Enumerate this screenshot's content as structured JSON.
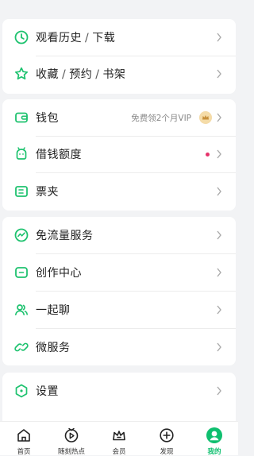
{
  "menu_groups": [
    [
      {
        "parts": [
          "观看历史",
          "下载"
        ]
      },
      {
        "parts": [
          "收藏",
          "预约",
          "书架"
        ]
      }
    ],
    [
      {
        "label": "钱包",
        "note": "免费领2个月VIP"
      },
      {
        "label": "借钱额度"
      },
      {
        "label": "票夹"
      }
    ],
    [
      {
        "label": "免流量服务"
      },
      {
        "label": "创作中心"
      },
      {
        "label": "一起聊"
      },
      {
        "label": "微服务"
      }
    ],
    [
      {
        "label": "设置"
      }
    ]
  ],
  "separator": "/",
  "tabbar": {
    "items": [
      {
        "label": "首页"
      },
      {
        "label": "随刻热点"
      },
      {
        "label": "会员"
      },
      {
        "label": "发现"
      },
      {
        "label": "我的"
      }
    ],
    "active": "我的"
  },
  "colors": {
    "accent": "#0fbf6f",
    "background": "#f2f3f5",
    "notification_dot": "#e6336b"
  },
  "icons": [
    "clock-icon",
    "star-icon",
    "wallet-icon",
    "loan-icon",
    "ticket-icon",
    "traffic-icon",
    "creator-icon",
    "chat-icon",
    "micro-service-icon",
    "settings-icon"
  ]
}
